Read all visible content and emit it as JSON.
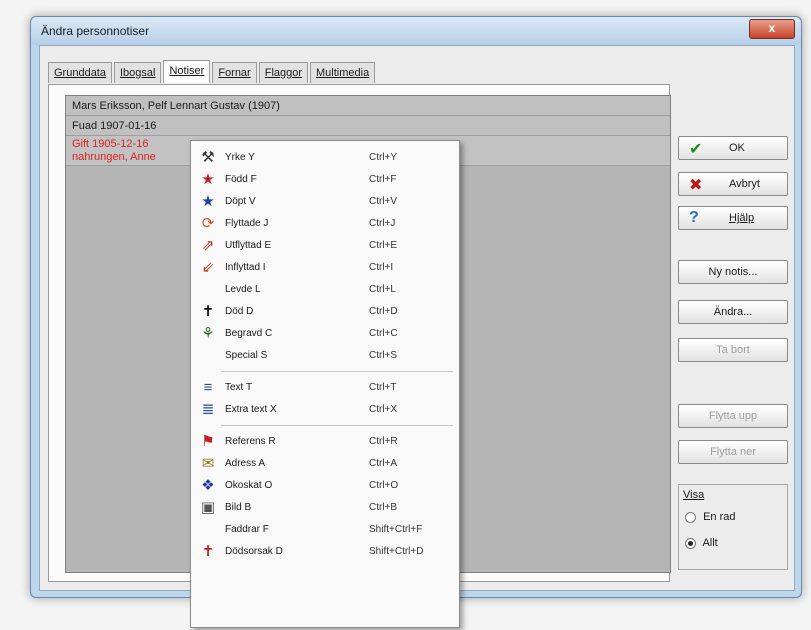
{
  "window": {
    "title": "Ändra personnotiser",
    "close_label": "x"
  },
  "tabs": [
    {
      "label": "Grunddata"
    },
    {
      "label": "Ibogsal"
    },
    {
      "label": "Notiser",
      "active": true
    },
    {
      "label": "Fornar"
    },
    {
      "label": "Flaggor"
    },
    {
      "label": "Multimedia"
    }
  ],
  "list": {
    "rows": [
      "Mars Eriksson, Pelf Lennart Gustav (1907)",
      "Fuad 1907-01-16",
      "Gift 1905-12-16",
      "   nahrungen, Anne"
    ]
  },
  "buttons": {
    "ok": "OK",
    "cancel": "Avbryt",
    "help": "Hjälp",
    "new_notice": "Ny notis...",
    "change": "Ändra...",
    "delete": "Ta bort",
    "move_up": "Flytta upp",
    "move_down": "Flytta ner"
  },
  "view_group": {
    "title": "Visa",
    "options": [
      {
        "label": "En rad",
        "selected": false
      },
      {
        "label": "Allt",
        "selected": true
      }
    ]
  },
  "menu": {
    "groups": [
      [
        {
          "label": "Yrke Y",
          "shortcut": "Ctrl+Y",
          "icon": "hammer-icon",
          "glyph": "⚒",
          "color": "#333333"
        },
        {
          "label": "Född F",
          "shortcut": "Ctrl+F",
          "icon": "star-red-icon",
          "glyph": "★",
          "color": "#c0202a"
        },
        {
          "label": "Döpt V",
          "shortcut": "Ctrl+V",
          "icon": "star-blue-icon",
          "glyph": "★",
          "color": "#1f3f9f"
        },
        {
          "label": "Flyttade J",
          "shortcut": "Ctrl+J",
          "icon": "move-icon",
          "glyph": "⟳",
          "color": "#d05020"
        },
        {
          "label": "Utflyttad E",
          "shortcut": "Ctrl+E",
          "icon": "move-out-icon",
          "glyph": "⇗",
          "color": "#c03020"
        },
        {
          "label": "Inflyttad I",
          "shortcut": "Ctrl+I",
          "icon": "move-in-icon",
          "glyph": "⇙",
          "color": "#c03020"
        },
        {
          "label": "Levde L",
          "shortcut": "Ctrl+L",
          "icon": "",
          "glyph": "",
          "color": "#333333"
        },
        {
          "label": "Död D",
          "shortcut": "Ctrl+D",
          "icon": "cross-icon",
          "glyph": "✝",
          "color": "#111111"
        },
        {
          "label": "Begravd C",
          "shortcut": "Ctrl+C",
          "icon": "shovel-icon",
          "glyph": "⚘",
          "color": "#2a6a2a"
        },
        {
          "label": "Special S",
          "shortcut": "Ctrl+S",
          "icon": "",
          "glyph": "",
          "color": "#333333"
        }
      ],
      [
        {
          "label": "Text T",
          "shortcut": "Ctrl+T",
          "icon": "text-icon",
          "glyph": "≡",
          "color": "#2a4a9a"
        },
        {
          "label": "Extra text X",
          "shortcut": "Ctrl+X",
          "icon": "extra-text-icon",
          "glyph": "≣",
          "color": "#2a4a9a"
        }
      ],
      [
        {
          "label": "Referens R",
          "shortcut": "Ctrl+R",
          "icon": "reference-icon",
          "glyph": "⚑",
          "color": "#c02020"
        },
        {
          "label": "Adress A",
          "shortcut": "Ctrl+A",
          "icon": "address-icon",
          "glyph": "✉",
          "color": "#8a7a10"
        },
        {
          "label": "Okoskat O",
          "shortcut": "Ctrl+O",
          "icon": "globe-icon",
          "glyph": "❖",
          "color": "#1f3f9f"
        },
        {
          "label": "Bild B",
          "shortcut": "Ctrl+B",
          "icon": "image-icon",
          "glyph": "▣",
          "color": "#555555"
        },
        {
          "label": "Faddrar F",
          "shortcut": "Shift+Ctrl+F",
          "icon": "",
          "glyph": "",
          "color": "#333333"
        },
        {
          "label": "Dödsorsak D",
          "shortcut": "Shift+Ctrl+D",
          "icon": "death-cause-icon",
          "glyph": "✝",
          "color": "#c02020"
        }
      ]
    ]
  }
}
